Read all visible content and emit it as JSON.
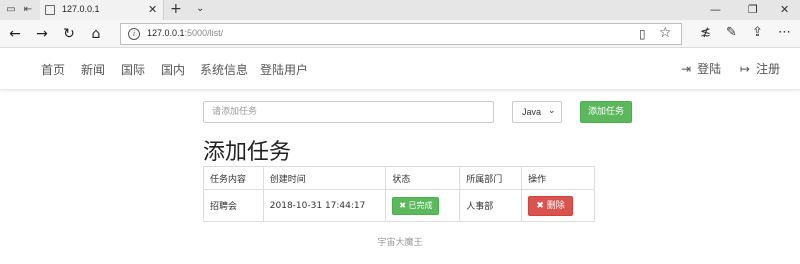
{
  "browser": {
    "tab_title": "127.0.0.1",
    "url_host": "127.0.0.1",
    "url_path": ":5000/list/",
    "icons": [
      "back-arrow",
      "forward-arrow",
      "refresh",
      "home",
      "info",
      "reader-view",
      "favorite-star",
      "hub",
      "pen",
      "share",
      "more"
    ]
  },
  "nav": {
    "items": [
      "首页",
      "新闻",
      "国际",
      "国内",
      "系统信息",
      "登陆用户"
    ],
    "login": "登陆",
    "register": "注册"
  },
  "form": {
    "placeholder": "请添加任务",
    "language": "Java",
    "add_button": "添加任务"
  },
  "heading": "添加任务",
  "table": {
    "headers": [
      "任务内容",
      "创建时间",
      "状态",
      "所属部门",
      "操作"
    ],
    "rows": [
      {
        "content": "招聘会",
        "created": "2018-10-31 17:44:17",
        "status": "已完成",
        "dept": "人事部",
        "action": "删除"
      }
    ]
  },
  "footer": "宇宙大魔王",
  "colors": {
    "success": "#5cb85c",
    "danger": "#d9534f"
  }
}
